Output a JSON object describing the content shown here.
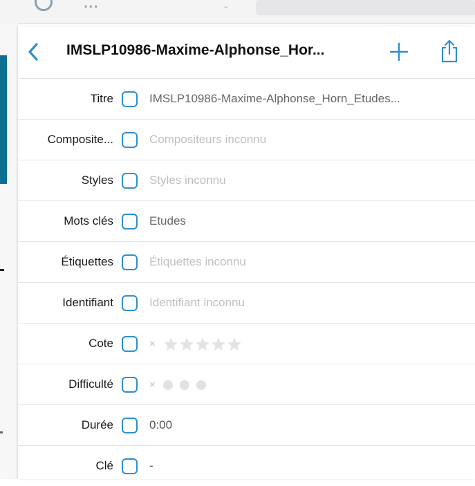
{
  "colors": {
    "accent": "#2c8ed0",
    "nav_accent": "#0d6f8f",
    "placeholder": "#bfbfc3",
    "star": "#e3e3e6"
  },
  "nav": {
    "title": "IMSLP10986-Maxime-Alphonse_Hor...",
    "back_icon": "chevron-left-icon",
    "add_icon": "plus-icon",
    "share_icon": "share-icon"
  },
  "fields": {
    "titre": {
      "label": "Titre",
      "value": "IMSLP10986-Maxime-Alphonse_Horn_Etudes..."
    },
    "compositeurs": {
      "label": "Composite...",
      "placeholder": "Compositeurs inconnu"
    },
    "styles": {
      "label": "Styles",
      "placeholder": "Styles inconnu"
    },
    "mots_cles": {
      "label": "Mots clés",
      "value": "Etudes"
    },
    "etiquettes": {
      "label": "Étiquettes",
      "placeholder": "Étiquettes inconnu"
    },
    "identifiant": {
      "label": "Identifiant",
      "placeholder": "Identifiant inconnu"
    },
    "cote": {
      "label": "Cote",
      "clear": "×",
      "rating": 0,
      "max": 5
    },
    "difficulte": {
      "label": "Difficulté",
      "clear": "×",
      "level": 0,
      "max": 3
    },
    "duree": {
      "label": "Durée",
      "value": "0:00"
    },
    "cle": {
      "label": "Clé",
      "value": "-"
    }
  }
}
